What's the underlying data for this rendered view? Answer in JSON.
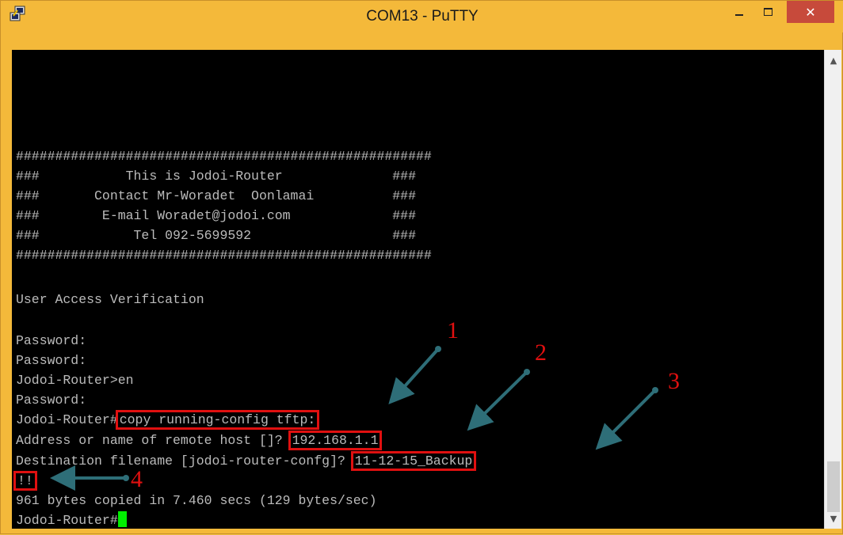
{
  "window": {
    "title": "COM13 - PuTTY",
    "controls": {
      "minimize": "–",
      "maximize": "□",
      "close": "✕"
    },
    "icon": "putty-icon"
  },
  "colors": {
    "terminal_bg": "#000000",
    "terminal_text": "#bbbbbb",
    "cursor": "#00ee00",
    "annotation": "#e01010",
    "arrow": "#2e6e78",
    "titlebar": "#f4b93a",
    "close_button": "#c74a3b"
  },
  "terminal": {
    "lines": [
      "#####################################################",
      "###           This is Jodoi-Router              ###",
      "###       Contact Mr-Woradet  Oonlamai          ###",
      "###        E-mail Woradet@jodoi.com             ###",
      "###            Tel 092-5699592                  ###",
      "#####################################################",
      "",
      "User Access Verification",
      "",
      "Password:",
      "Password:",
      "Jodoi-Router>en",
      "Password:"
    ],
    "cmd1_prompt": "Jodoi-Router#",
    "cmd1_value": "copy running-config tftp:",
    "cmd2_prompt": "Address or name of remote host []? ",
    "cmd2_value": "192.168.1.1",
    "cmd3_prompt": "Destination filename [jodoi-router-confg]? ",
    "cmd3_value": "11-12-15_Backup",
    "progress": "!!",
    "result": "961 bytes copied in 7.460 secs (129 bytes/sec)",
    "final_prompt": "Jodoi-Router#"
  },
  "annotations": [
    "1",
    "2",
    "3",
    "4"
  ]
}
